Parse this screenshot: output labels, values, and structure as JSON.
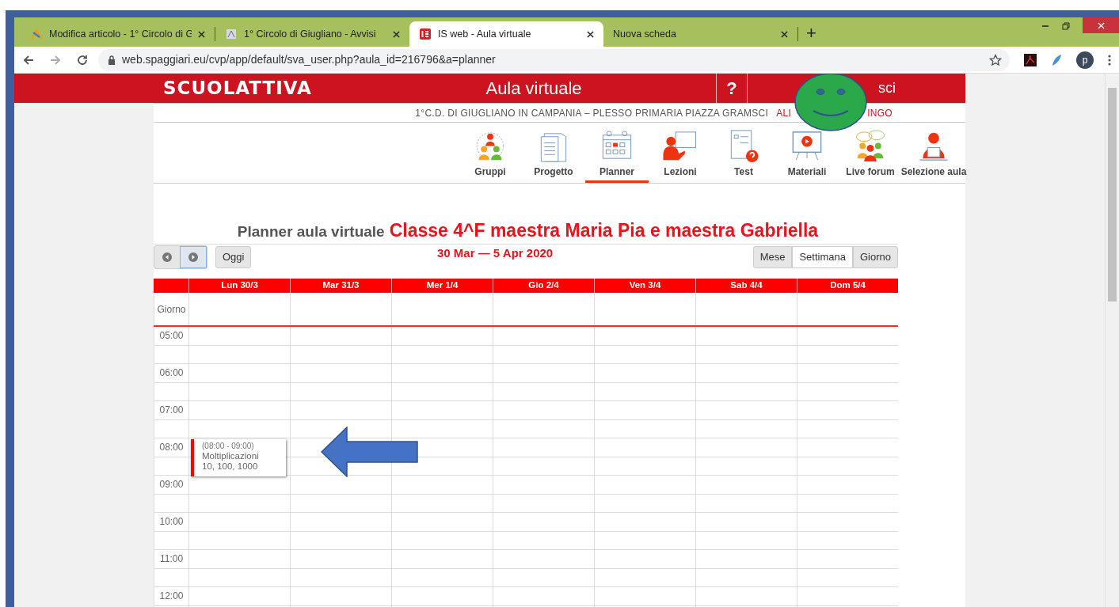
{
  "browser": {
    "tabs": [
      {
        "title": "Modifica articolo - 1° Circolo di G",
        "selected": false,
        "kind": "joomla"
      },
      {
        "title": "1° Circolo di Giugliano - Avvisi",
        "selected": false,
        "kind": "school"
      },
      {
        "title": "IS web - Aula virtuale",
        "selected": true,
        "kind": "isweb"
      },
      {
        "title": "Nuova scheda",
        "selected": false,
        "kind": "blank"
      }
    ],
    "new_tab": "+",
    "url": "web.spaggiari.eu/cvp/app/default/sva_user.php?aula_id=216796&a=planner",
    "profile": "p"
  },
  "header": {
    "logo": "SCUOLATTIVA",
    "title": "Aula virtuale",
    "help": "?",
    "exit": "sci"
  },
  "school_line": {
    "school": "1°C.D. DI GIUGLIANO IN CAMPANIA – PLESSO PRIMARIA PIAZZA GRAMSCI",
    "user_start": "ALI",
    "user_end": "INGO"
  },
  "nav": [
    {
      "label": "Gruppi",
      "kind": "group",
      "selected": false
    },
    {
      "label": "Progetto",
      "kind": "document",
      "selected": false
    },
    {
      "label": "Planner",
      "kind": "calendar",
      "selected": true
    },
    {
      "label": "Lezioni",
      "kind": "lesson",
      "selected": false
    },
    {
      "label": "Test",
      "kind": "test",
      "selected": false
    },
    {
      "label": "Materiali",
      "kind": "video",
      "selected": false
    },
    {
      "label": "Live forum",
      "kind": "forum",
      "selected": false
    },
    {
      "label": "Selezione aula",
      "kind": "user",
      "selected": false
    }
  ],
  "planner": {
    "title": "Planner aula virtuale",
    "class_name": "Classe 4^F maestra Maria Pia e maestra Gabriella",
    "range": "30 Mar — 5 Apr 2020",
    "today": "Oggi",
    "views": [
      {
        "label": "Mese",
        "selected": false
      },
      {
        "label": "Settimana",
        "selected": true
      },
      {
        "label": "Giorno",
        "selected": false
      }
    ],
    "days": [
      "Lun 30/3",
      "Mar 31/3",
      "Mer 1/4",
      "Gio 2/4",
      "Ven 3/4",
      "Sab 4/4",
      "Dom 5/4"
    ],
    "all_day": "Giorno",
    "hours": [
      "05:00",
      "06:00",
      "07:00",
      "08:00",
      "09:00",
      "10:00",
      "11:00",
      "12:00"
    ],
    "event": {
      "time": "(08:00 - 09:00)",
      "lines": [
        "Moltiplicazioni",
        "10, 100, 1000"
      ]
    }
  }
}
